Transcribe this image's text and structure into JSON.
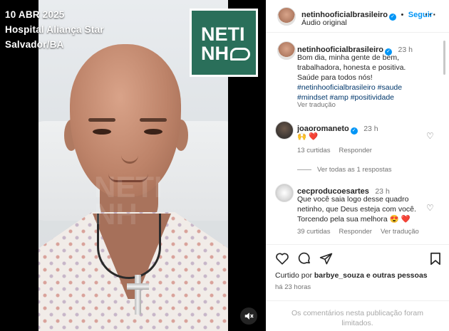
{
  "video": {
    "overlay_date": "10 ABR 2025",
    "overlay_place": "Hospital Aliança Star",
    "overlay_city": "Salvador/BA",
    "logo_line1": "NETI",
    "logo_line2": "NH",
    "logo_color": "#2a6f5a",
    "mute_icon": "speaker-muted-icon"
  },
  "header": {
    "username": "netinhooficialbrasileiro",
    "separator": "•",
    "follow_label": "Seguir",
    "audio_label": "Áudio original",
    "more_icon": "more-horizontal-icon"
  },
  "post": {
    "username": "netinhooficialbrasileiro",
    "time": "23 h",
    "caption": "Bom dia, minha gente de bem, trabalhadora, honesta e positiva. Saúde para todos nós!",
    "hashtags_line1": "#netinhooficialbrasileiro #saude",
    "hashtags_line2": "#mindset #amp #positividade",
    "translate_label": "Ver tradução"
  },
  "comments": [
    {
      "username": "joaoromaneto",
      "time": "23 h",
      "text": "🙌 ❤️",
      "likes": "13 curtidas",
      "reply_label": "Responder",
      "view_replies": "Ver todas as 1 respostas"
    },
    {
      "username": "cecproducoesartes",
      "time": "23 h",
      "text_line1": "Que você saia logo desse quadro",
      "text_line2": "netinho, que Deus esteja com você.",
      "text_line3": "Torcendo pela sua melhora 😍 ❤️",
      "likes": "39 curtidas",
      "reply_label": "Responder",
      "translate_label": "Ver tradução"
    }
  ],
  "actions": {
    "liked_by_prefix": "Curtido por",
    "liked_by_user": "barbye_souza",
    "liked_by_suffix": "e outras pessoas",
    "time_ago": "há 23 horas"
  },
  "footer": {
    "line1": "Os comentários nesta publicação foram",
    "line2": "limitados."
  },
  "colors": {
    "accent": "#0095f6",
    "link": "#00376b",
    "like_red": "#ed4956",
    "muted": "#737373"
  }
}
